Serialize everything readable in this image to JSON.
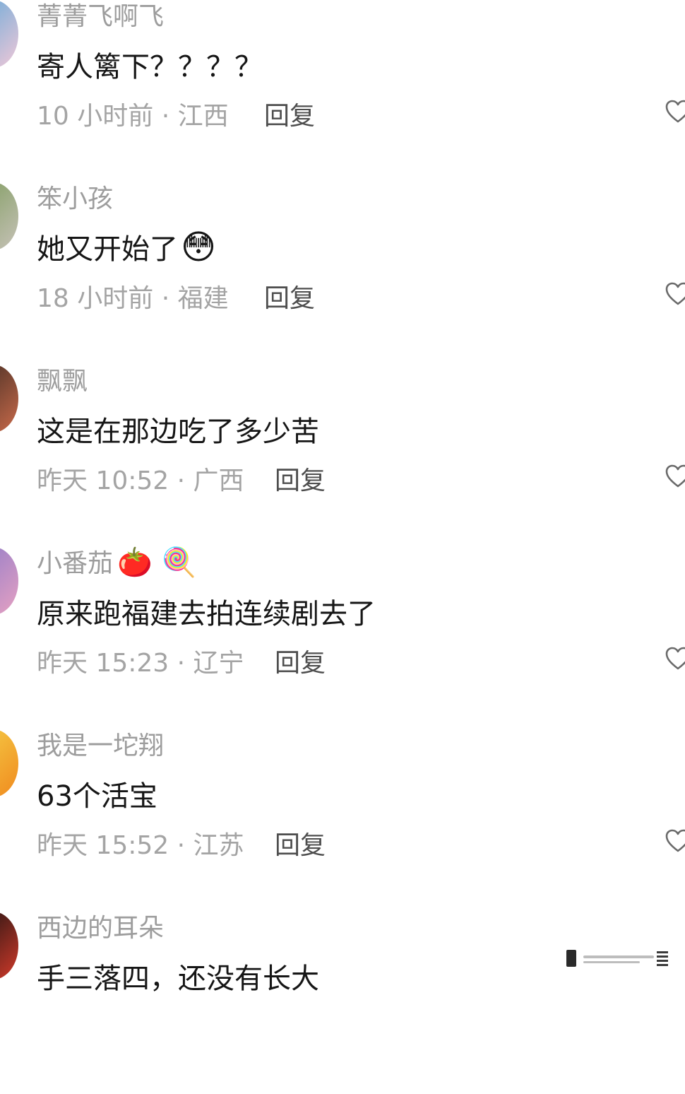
{
  "comments": [
    {
      "username": "菁菁飞啊飞",
      "username_emoji": "",
      "text": "寄人篱下？？？？",
      "text_emoji": "",
      "time": "10 小时前",
      "location": "江西",
      "reply_label": "回复",
      "avatar_colors": [
        "#5fa8d8",
        "#f0c8d8"
      ]
    },
    {
      "username": "笨小孩",
      "username_emoji": "",
      "text": "她又开始了",
      "text_emoji": "😳",
      "time": "18 小时前",
      "location": "福建",
      "reply_label": "回复",
      "avatar_colors": [
        "#7b9a5a",
        "#c7c2b8"
      ]
    },
    {
      "username": "飘飘",
      "username_emoji": "",
      "text": "这是在那边吃了多少苦",
      "text_emoji": "",
      "time": "昨天 10:52",
      "location": "广西",
      "reply_label": "回复",
      "avatar_colors": [
        "#3b2a22",
        "#c96a4a"
      ]
    },
    {
      "username": "小番茄",
      "username_emoji": "🍅 🍭",
      "text": "原来跑福建去拍连续剧去了",
      "text_emoji": "",
      "time": "昨天 15:23",
      "location": "辽宁",
      "reply_label": "回复",
      "avatar_colors": [
        "#8c7ac9",
        "#e6a1c2"
      ]
    },
    {
      "username": "我是一坨翔",
      "username_emoji": "",
      "text": "63个活宝",
      "text_emoji": "",
      "time": "昨天 15:52",
      "location": "江苏",
      "reply_label": "回复",
      "avatar_colors": [
        "#f5d24a",
        "#f08a1e"
      ]
    },
    {
      "username": "西边的耳朵",
      "username_emoji": "",
      "text": "手三落四，还没有长大",
      "text_emoji": "",
      "time": "",
      "location": "",
      "reply_label": "",
      "avatar_colors": [
        "#111111",
        "#d23a2a"
      ]
    }
  ]
}
